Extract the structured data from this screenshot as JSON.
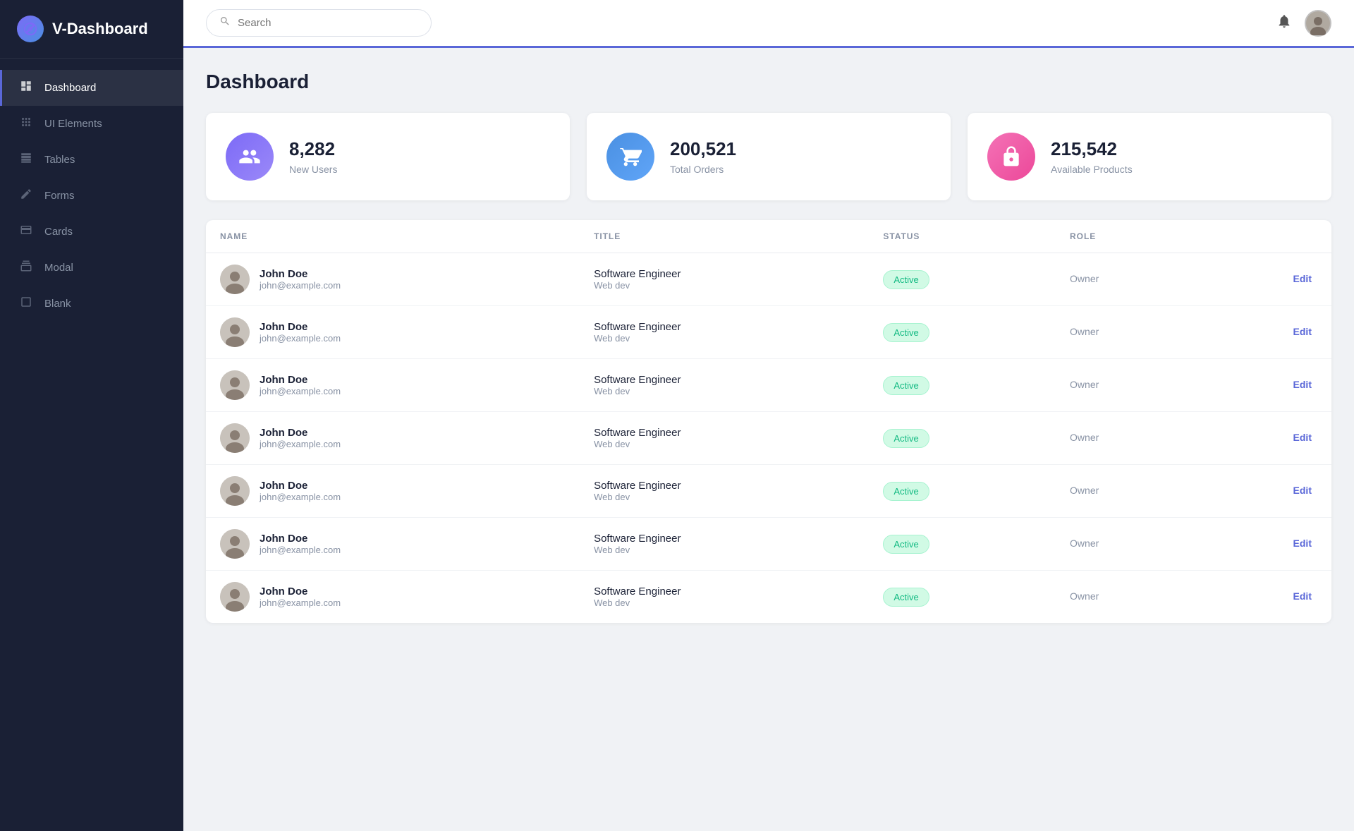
{
  "sidebar": {
    "logo_text": "V-Dashboard",
    "logo_icon": "🔥",
    "items": [
      {
        "id": "dashboard",
        "label": "Dashboard",
        "icon": "⬤",
        "active": true
      },
      {
        "id": "ui-elements",
        "label": "UI Elements",
        "icon": "⠿",
        "active": false
      },
      {
        "id": "tables",
        "label": "Tables",
        "icon": "▤",
        "active": false
      },
      {
        "id": "forms",
        "label": "Forms",
        "icon": "✎",
        "active": false
      },
      {
        "id": "cards",
        "label": "Cards",
        "icon": "▬",
        "active": false
      },
      {
        "id": "modal",
        "label": "Modal",
        "icon": "◫",
        "active": false
      },
      {
        "id": "blank",
        "label": "Blank",
        "icon": "▭",
        "active": false
      }
    ]
  },
  "header": {
    "search_placeholder": "Search"
  },
  "page": {
    "title": "Dashboard"
  },
  "stats": [
    {
      "id": "users",
      "number": "8,282",
      "label": "New Users",
      "icon_type": "users"
    },
    {
      "id": "orders",
      "number": "200,521",
      "label": "Total Orders",
      "icon_type": "orders"
    },
    {
      "id": "products",
      "number": "215,542",
      "label": "Available Products",
      "icon_type": "products"
    }
  ],
  "table": {
    "columns": [
      "NAME",
      "TITLE",
      "STATUS",
      "ROLE"
    ],
    "rows": [
      {
        "name": "John Doe",
        "email": "john@example.com",
        "title": "Software Engineer",
        "subtitle": "Web dev",
        "status": "Active",
        "role": "Owner"
      },
      {
        "name": "John Doe",
        "email": "john@example.com",
        "title": "Software Engineer",
        "subtitle": "Web dev",
        "status": "Active",
        "role": "Owner"
      },
      {
        "name": "John Doe",
        "email": "john@example.com",
        "title": "Software Engineer",
        "subtitle": "Web dev",
        "status": "Active",
        "role": "Owner"
      },
      {
        "name": "John Doe",
        "email": "john@example.com",
        "title": "Software Engineer",
        "subtitle": "Web dev",
        "status": "Active",
        "role": "Owner"
      },
      {
        "name": "John Doe",
        "email": "john@example.com",
        "title": "Software Engineer",
        "subtitle": "Web dev",
        "status": "Active",
        "role": "Owner"
      },
      {
        "name": "John Doe",
        "email": "john@example.com",
        "title": "Software Engineer",
        "subtitle": "Web dev",
        "status": "Active",
        "role": "Owner"
      },
      {
        "name": "John Doe",
        "email": "john@example.com",
        "title": "Software Engineer",
        "subtitle": "Web dev",
        "status": "Active",
        "role": "Owner"
      }
    ],
    "edit_label": "Edit"
  },
  "icons": {
    "search": "🔍",
    "bell": "🔔",
    "users_icon": "👥",
    "cart_icon": "🛒",
    "lock_icon": "🔒",
    "person_icon": "👤"
  }
}
